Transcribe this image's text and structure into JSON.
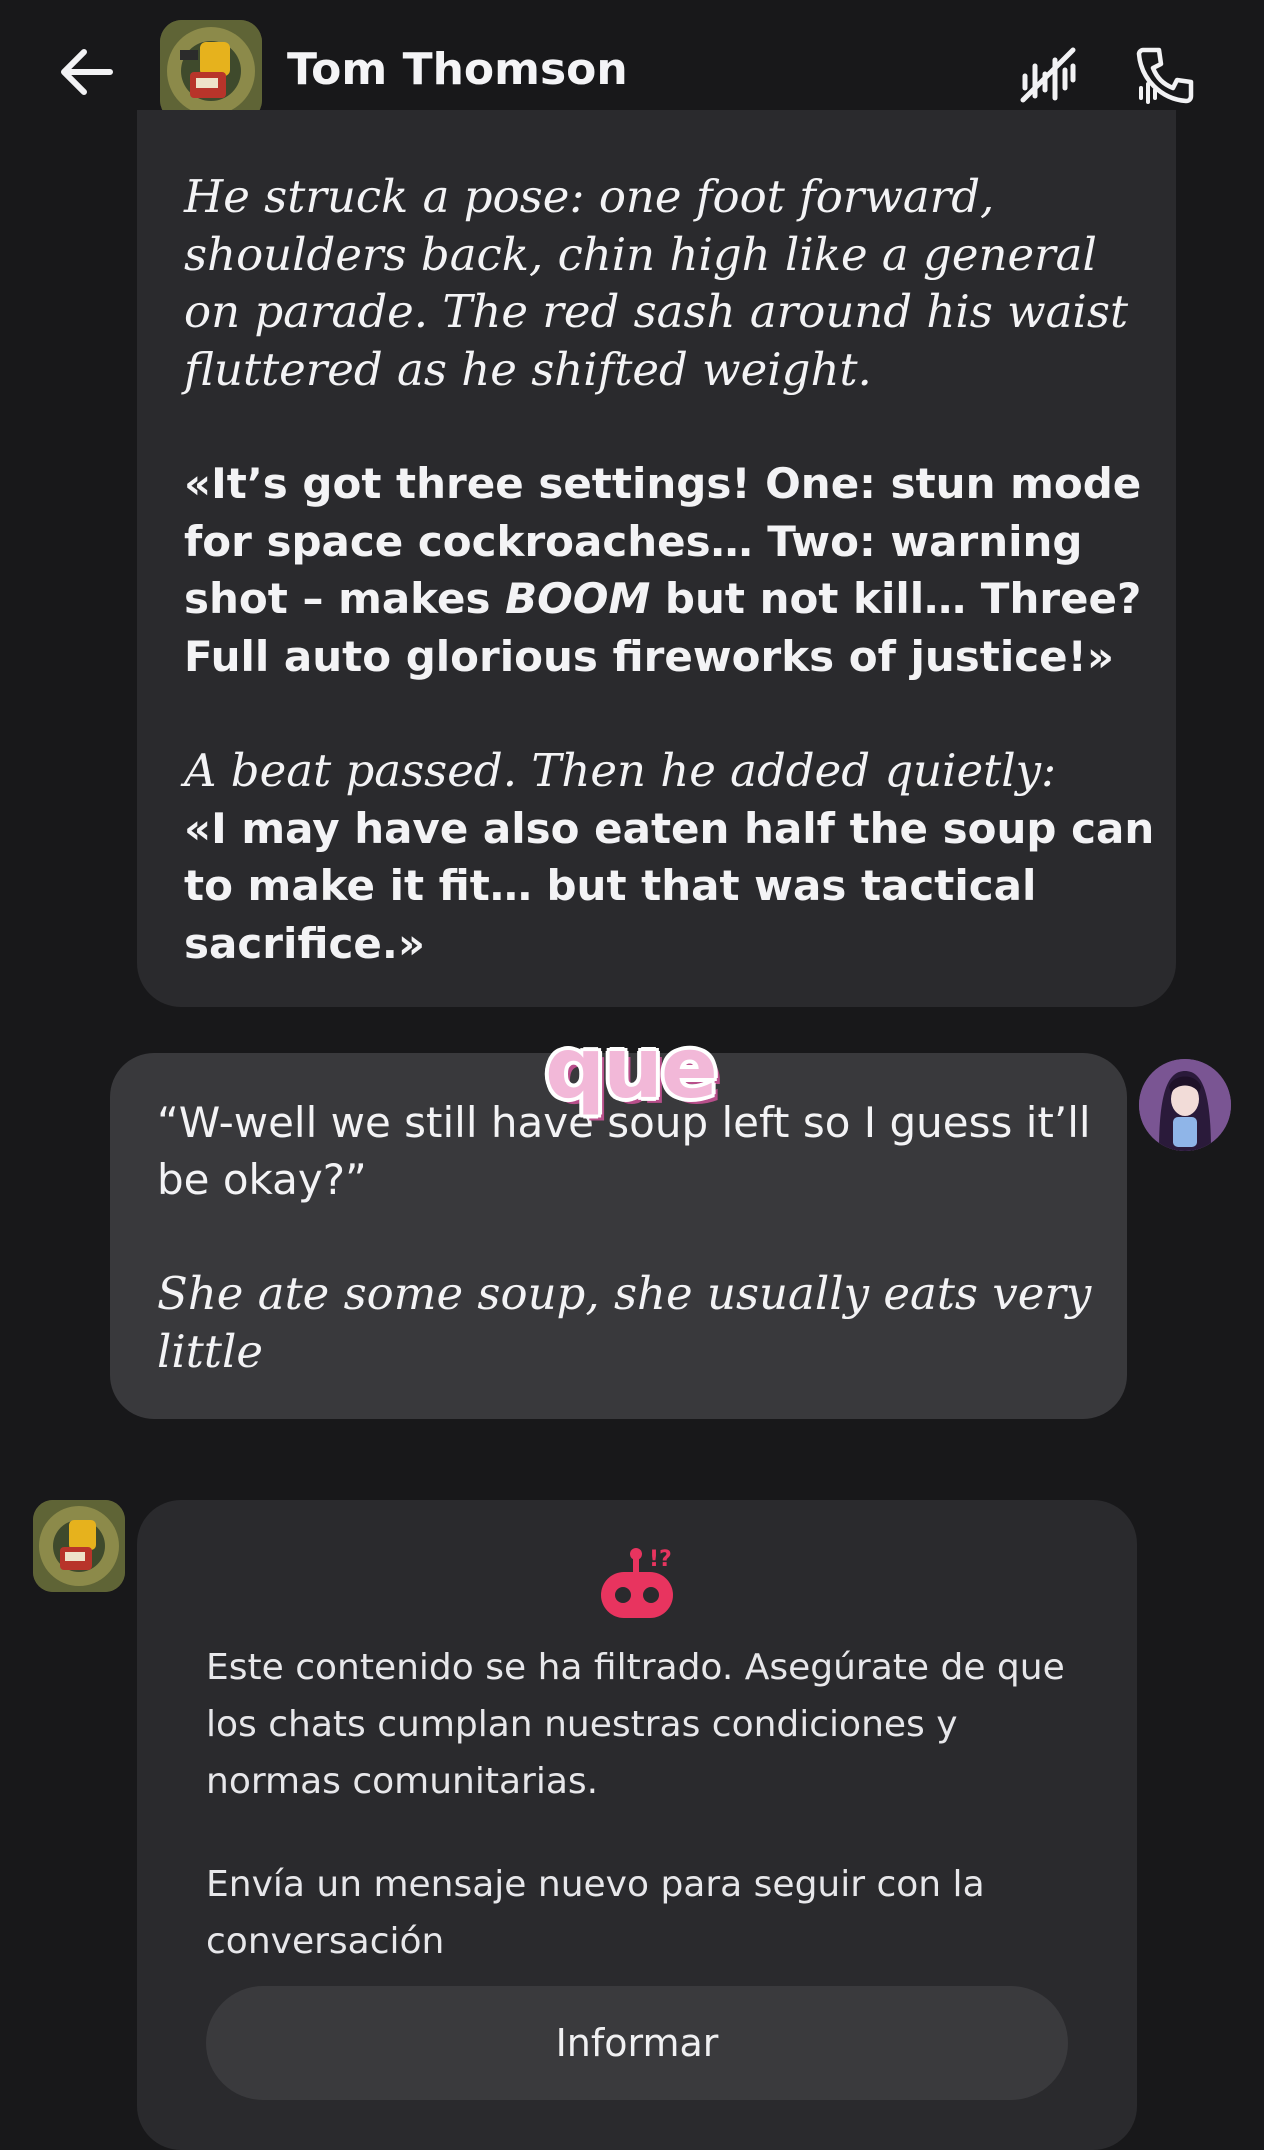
{
  "header": {
    "character_name": "Tom Thomson",
    "icons": [
      "arrow-left-icon",
      "mute-voice-icon",
      "phone-call-icon"
    ]
  },
  "messages": [
    {
      "sender": "character",
      "paragraphs": [
        {
          "style": "narration",
          "text": "He struck a pose: one foot forward, shoulders back, chin high like a general on parade. The red sash around his waist fluttered as he shifted weight."
        },
        {
          "style": "speech",
          "parts": [
            "«It’s got three settings! One: stun mode for space cockroaches… Two: warning shot – makes ",
            "BOOM",
            " but not kill… Three? Full auto glorious fireworks of justice!»"
          ]
        },
        {
          "style": "narration",
          "text": "A beat passed. Then he added quietly:"
        },
        {
          "style": "speech",
          "text": "«I may have also eaten half the soup can to make it fit… but that was tactical sacrifice.»"
        }
      ]
    },
    {
      "sender": "user",
      "paragraphs": [
        {
          "style": "speech",
          "text": "“W-well we still have soup left so I guess it’ll be okay?”"
        },
        {
          "style": "narration",
          "text": "She ate some soup, she usually eats very little"
        }
      ]
    },
    {
      "sender": "system",
      "paragraphs": [
        {
          "text": "Este contenido se ha filtrado. Asegúrate de que los chats cumplan nuestras condiciones y normas comunitarias."
        },
        {
          "text": "Envía un mensaje nuevo para seguir con la conversación"
        }
      ],
      "button_label": "Informar",
      "icon": "filtered-robot-icon",
      "icon_color": "#e8345f"
    }
  ],
  "sticker": {
    "text": "que",
    "color": "#f2b8d8"
  }
}
